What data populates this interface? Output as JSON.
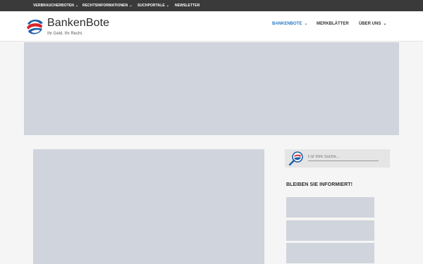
{
  "topbar": {
    "items": [
      {
        "label": "VERBRAUCHERBOTEN",
        "dropdown": true
      },
      {
        "label": "RECHTSINFORMATIONEN",
        "dropdown": true
      },
      {
        "label": "SUCHPORTALE",
        "dropdown": true
      },
      {
        "label": "NEWSLETTER",
        "dropdown": false
      }
    ]
  },
  "header": {
    "brand": "BankenBote",
    "tagline": "Ihr Geld. Ihr Recht.",
    "nav": [
      {
        "label": "BANKENBOTE",
        "dropdown": true,
        "active": true
      },
      {
        "label": "MERKBLÄTTER",
        "dropdown": false,
        "active": false
      },
      {
        "label": "ÜBER UNS",
        "dropdown": true,
        "active": false
      }
    ]
  },
  "sidebar": {
    "search": {
      "placeholder": "Für Ihre Suche...",
      "value": ""
    },
    "heading": "BLEIBEN SIE INFORMIERT!"
  },
  "icons": {
    "chevron": "chevron-down-icon",
    "logo": "bankenbote-logo-icon",
    "search": "magnifier-search-icon"
  },
  "colors": {
    "topbar_bg": "#3a3a3a",
    "active_nav": "#2a7bc4",
    "placeholder_block": "#d0d4dc",
    "logo_red": "#d8232a",
    "logo_blue": "#1d5fa8"
  }
}
